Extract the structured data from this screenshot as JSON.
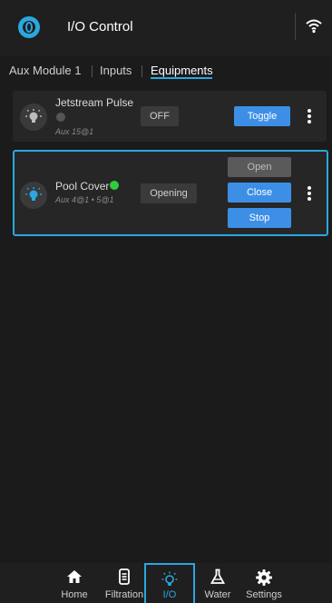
{
  "header": {
    "title": "I/O Control"
  },
  "tabs": [
    {
      "label": "Aux Module 1"
    },
    {
      "label": "Inputs"
    },
    {
      "label": "Equipments"
    }
  ],
  "equipment": [
    {
      "name": "Jetstream Pulse",
      "sub": "Aux 15@1",
      "status_dot": "#555555",
      "state": "OFF",
      "buttons": [
        "Toggle"
      ]
    },
    {
      "name": "Pool Cover",
      "sub": "Aux 4@1 • 5@1",
      "status_dot": "#2ecc40",
      "state": "Opening",
      "buttons": [
        "Open",
        "Close",
        "Stop"
      ]
    }
  ],
  "bottom_nav": [
    {
      "label": "Home",
      "icon": "home-icon"
    },
    {
      "label": "Filtration",
      "icon": "filtration-icon"
    },
    {
      "label": "I/O",
      "icon": "lightbulb-icon"
    },
    {
      "label": "Water",
      "icon": "flask-icon"
    },
    {
      "label": "Settings",
      "icon": "gear-icon"
    }
  ],
  "colors": {
    "accent": "#2aa7e0",
    "button": "#3d8fe6",
    "active_dot": "#2ecc40"
  }
}
